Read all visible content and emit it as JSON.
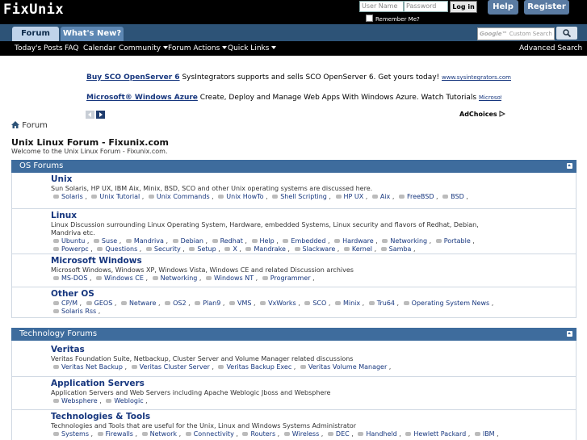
{
  "header": {
    "logo": "FixUnix",
    "username_placeholder": "User Name",
    "password_placeholder": "Password",
    "login_label": "Log in",
    "remember_label": "Remember Me?",
    "help_label": "Help",
    "register_label": "Register"
  },
  "nav": {
    "tabs": [
      {
        "label": "Forum"
      },
      {
        "label": "What's New?"
      }
    ],
    "search_placeholder": "Custom Search",
    "search_brand": "Google™",
    "sub_items": [
      {
        "label": "Today's Posts"
      },
      {
        "label": "FAQ"
      },
      {
        "label": "Calendar"
      },
      {
        "label": "Community"
      },
      {
        "label": "Forum Actions"
      },
      {
        "label": "Quick Links"
      }
    ],
    "advanced_search": "Advanced Search"
  },
  "ads": [
    {
      "title": "Buy SCO OpenServer 6",
      "text": " SysIntegrators supports and sells SCO OpenServer 6. Get yours today! ",
      "url": "www.sysintegrators.com"
    },
    {
      "title": "Microsoft® Windows Azure",
      "text": " Create, Deploy and Manage Web Apps With Windows Azure. Watch Tutorials ",
      "url": "Microsoft.com/Cloud/Wi"
    }
  ],
  "adchoices": "AdChoices",
  "breadcrumb": "Forum",
  "page": {
    "title": "Unix Linux Forum - Fixunix.com",
    "welcome": "Welcome to the Unix Linux Forum - Fixunix.com."
  },
  "sections": [
    {
      "title": "OS Forums",
      "forums": [
        {
          "title": "Unix",
          "desc": "Sun Solaris, HP UX, IBM Aix, Minix, BSD, SCO and other Unix operating systems are discussed here.",
          "subs": [
            "Solaris",
            "Unix Tutorial",
            "Unix Commands",
            "Unix HowTo",
            "Shell Scripting",
            "HP UX",
            "Aix",
            "FreeBSD",
            "BSD"
          ]
        },
        {
          "title": "Linux",
          "desc": "Linux Discussion surrounding Linux Operating System, Hardware, embedded Systems, Linux security and flavors of Redhat, Debian, Mandriva etc.",
          "subs": [
            "Ubuntu",
            "Suse",
            "Mandriva",
            "Debian",
            "Redhat",
            "Help",
            "Embedded",
            "Hardware",
            "Networking",
            "Portable",
            "Powerpc",
            "Questions",
            "Security",
            "Setup",
            "X",
            "Mandrake",
            "Slackware",
            "Kernel",
            "Samba"
          ]
        },
        {
          "title": "Microsoft Windows",
          "desc": "Microsoft Windows, Windows XP, Windows Vista, Windows CE and related Discussion archives",
          "subs": [
            "MS-DOS",
            "Windows CE",
            "Networking",
            "Windows NT",
            "Programmer"
          ]
        },
        {
          "title": "Other OS",
          "desc": "",
          "subs": [
            "CP/M",
            "GEOS",
            "Netware",
            "OS2",
            "Plan9",
            "VMS",
            "VxWorks",
            "SCO",
            "Minix",
            "Tru64",
            "Operating System News",
            "Solaris Rss"
          ]
        }
      ]
    },
    {
      "title": "Technology Forums",
      "forums": [
        {
          "title": "Veritas",
          "desc": "Veritas Foundation Suite, Netbackup, Cluster Server and Volume Manager related discussions",
          "subs": [
            "Veritas Net Backup",
            "Veritas Cluster Server",
            "Veritas Backup Exec",
            "Veritas Volume Manager"
          ]
        },
        {
          "title": "Application Servers",
          "desc": "Application Servers and Web Servers including Apache Weblogic Jboss and Websphere",
          "subs": [
            "Websphere",
            "Weblogic"
          ]
        },
        {
          "title": "Technologies & Tools",
          "desc": "Technologies and Tools that are useful for the Unix, Linux and Windows Systems Administrator",
          "subs": [
            "Systems",
            "Firewalls",
            "Network",
            "Connectivity",
            "Routers",
            "Wireless",
            "DEC",
            "Handheld",
            "Hewlett Packard",
            "IBM"
          ]
        }
      ]
    }
  ],
  "colors": {
    "topbar": "#000000",
    "navbar": "#2d5377",
    "section_header": "#3e6c9d",
    "link": "#16367e",
    "button": "#5a7ba2"
  }
}
